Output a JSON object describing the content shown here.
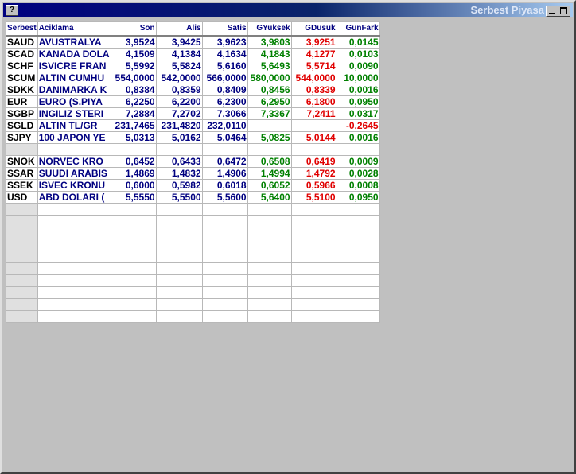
{
  "window": {
    "title": "Serbest Piyasa",
    "system_menu_label": "?"
  },
  "columns": [
    "Serbest",
    "Aciklama",
    "Son",
    "Alis",
    "Satis",
    "GYuksek",
    "GDusuk",
    "GunFark"
  ],
  "rows": [
    {
      "code": "SAUD",
      "desc": "AVUSTRALYA",
      "son": "3,9524",
      "alis": "3,9425",
      "satis": "3,9623",
      "gyuksek": "3,9803",
      "gdusuk": "3,9251",
      "gunfark": "0,0145"
    },
    {
      "code": "SCAD",
      "desc": "KANADA DOLA",
      "son": "4,1509",
      "alis": "4,1384",
      "satis": "4,1634",
      "gyuksek": "4,1843",
      "gdusuk": "4,1277",
      "gunfark": "0,0103"
    },
    {
      "code": "SCHF",
      "desc": "ISVICRE FRAN",
      "son": "5,5992",
      "alis": "5,5824",
      "satis": "5,6160",
      "gyuksek": "5,6493",
      "gdusuk": "5,5714",
      "gunfark": "0,0090"
    },
    {
      "code": "SCUM",
      "desc": "ALTIN CUMHU",
      "son": "554,0000",
      "alis": "542,0000",
      "satis": "566,0000",
      "gyuksek": "580,0000",
      "gdusuk": "544,0000",
      "gunfark": "10,0000"
    },
    {
      "code": "SDKK",
      "desc": "DANIMARKA K",
      "son": "0,8384",
      "alis": "0,8359",
      "satis": "0,8409",
      "gyuksek": "0,8456",
      "gdusuk": "0,8339",
      "gunfark": "0,0016"
    },
    {
      "code": "EUR",
      "desc": "EURO (S.PIYA",
      "son": "6,2250",
      "alis": "6,2200",
      "satis": "6,2300",
      "gyuksek": "6,2950",
      "gdusuk": "6,1800",
      "gunfark": "0,0950"
    },
    {
      "code": "SGBP",
      "desc": "INGILIZ STERI",
      "son": "7,2884",
      "alis": "7,2702",
      "satis": "7,3066",
      "gyuksek": "7,3367",
      "gdusuk": "7,2411",
      "gunfark": "0,0317"
    },
    {
      "code": "SGLD",
      "desc": "ALTIN TL/GR",
      "son": "231,7465",
      "alis": "231,4820",
      "satis": "232,0110",
      "gyuksek": "",
      "gdusuk": "",
      "gunfark": "-0,2645"
    },
    {
      "code": "SJPY",
      "desc": "100 JAPON YE",
      "son": "5,0313",
      "alis": "5,0162",
      "satis": "5,0464",
      "gyuksek": "5,0825",
      "gdusuk": "5,0144",
      "gunfark": "0,0016"
    },
    {
      "code": "",
      "desc": "",
      "son": "",
      "alis": "",
      "satis": "",
      "gyuksek": "",
      "gdusuk": "",
      "gunfark": ""
    },
    {
      "code": "SNOK",
      "desc": "NORVEC KRO",
      "son": "0,6452",
      "alis": "0,6433",
      "satis": "0,6472",
      "gyuksek": "0,6508",
      "gdusuk": "0,6419",
      "gunfark": "0,0009"
    },
    {
      "code": "SSAR",
      "desc": "SUUDI ARABIS",
      "son": "1,4869",
      "alis": "1,4832",
      "satis": "1,4906",
      "gyuksek": "1,4994",
      "gdusuk": "1,4792",
      "gunfark": "0,0028"
    },
    {
      "code": "SSEK",
      "desc": "ISVEC KRONU",
      "son": "0,6000",
      "alis": "0,5982",
      "satis": "0,6018",
      "gyuksek": "0,6052",
      "gdusuk": "0,5966",
      "gunfark": "0,0008"
    },
    {
      "code": "USD",
      "desc": "ABD DOLARI (",
      "son": "5,5550",
      "alis": "5,5500",
      "satis": "5,5600",
      "gyuksek": "5,6400",
      "gdusuk": "5,5100",
      "gunfark": "0,0950"
    }
  ],
  "empty_row_count": 10,
  "colors": {
    "header_text": "#000080",
    "up": "#008000",
    "down": "#e00000",
    "title_bar": "#000080"
  }
}
